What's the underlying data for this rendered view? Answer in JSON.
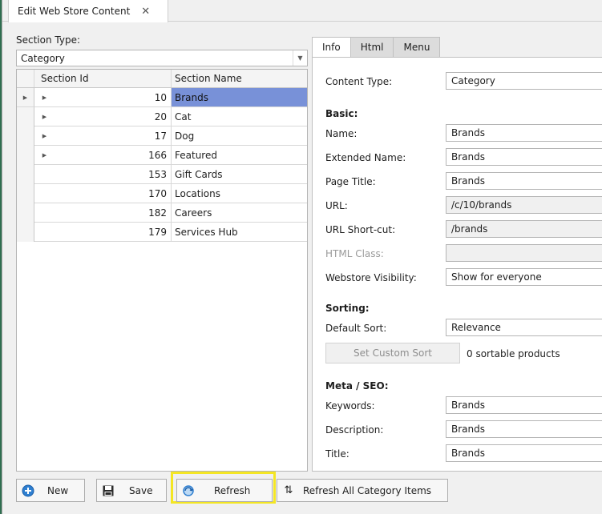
{
  "tab": {
    "title": "Edit Web Store Content",
    "close": "✕"
  },
  "section_type": {
    "label": "Section Type:",
    "value": "Category"
  },
  "grid": {
    "columns": [
      "Section Id",
      "Section Name"
    ],
    "rows": [
      {
        "id": "10",
        "name": "Brands",
        "expandable": true,
        "selected": true
      },
      {
        "id": "20",
        "name": "Cat",
        "expandable": true
      },
      {
        "id": "17",
        "name": "Dog",
        "expandable": true
      },
      {
        "id": "166",
        "name": "Featured",
        "expandable": true
      },
      {
        "id": "153",
        "name": "Gift Cards",
        "expandable": false
      },
      {
        "id": "170",
        "name": "Locations",
        "expandable": false
      },
      {
        "id": "182",
        "name": "Careers",
        "expandable": false
      },
      {
        "id": "179",
        "name": "Services Hub",
        "expandable": false
      }
    ]
  },
  "panel_tabs": [
    "Info",
    "Html",
    "Menu"
  ],
  "info": {
    "content_type_label": "Content Type:",
    "content_type_value": "Category",
    "basic_heading": "Basic:",
    "name_label": "Name:",
    "name_value": "Brands",
    "ext_name_label": "Extended Name:",
    "ext_name_value": "Brands",
    "page_title_label": "Page Title:",
    "page_title_value": "Brands",
    "url_label": "URL:",
    "url_value": "/c/10/brands",
    "url_short_label": "URL Short-cut:",
    "url_short_value": "/brands",
    "html_class_label": "HTML Class:",
    "html_class_value": "",
    "visibility_label": "Webstore Visibility:",
    "visibility_value": "Show for everyone",
    "sorting_heading": "Sorting:",
    "default_sort_label": "Default Sort:",
    "default_sort_value": "Relevance",
    "custom_sort_button": "Set Custom Sort",
    "sortable_count": "0 sortable products",
    "meta_heading": "Meta / SEO:",
    "keywords_label": "Keywords:",
    "keywords_value": "Brands",
    "description_label": "Description:",
    "description_value": "Brands",
    "title_label": "Title:",
    "title_value": "Brands"
  },
  "toolbar": {
    "new_label": "New",
    "save_label": "Save",
    "refresh_label": "Refresh",
    "refresh_all_label": "Refresh All Category Items"
  },
  "colors": {
    "selection": "#7891d8",
    "highlight": "#f4e623",
    "accent_icon": "#1e6fc8"
  }
}
